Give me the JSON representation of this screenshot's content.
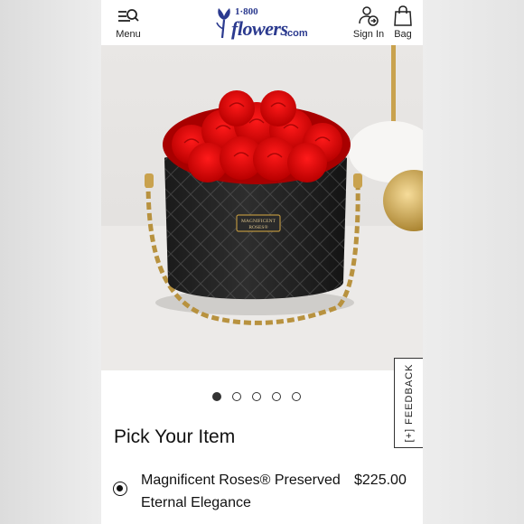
{
  "header": {
    "menu_label": "Menu",
    "logo_top": "1·800",
    "logo_main": "flowers",
    "logo_suffix": ".com",
    "signin_label": "Sign In",
    "bag_label": "Bag",
    "brand_color": "#2b3a8f"
  },
  "product_image": {
    "badge_line1": "MAGNIFICENT",
    "badge_line2": "ROSES®"
  },
  "carousel": {
    "count": 5,
    "active_index": 0
  },
  "feedback": {
    "label": "[+] FEEDBACK"
  },
  "section": {
    "heading": "Pick Your Item"
  },
  "option": {
    "name_line1": "Magnificent Roses® Preserved",
    "name_line2": "Eternal Elegance",
    "price": "$225.00",
    "selected": true
  }
}
